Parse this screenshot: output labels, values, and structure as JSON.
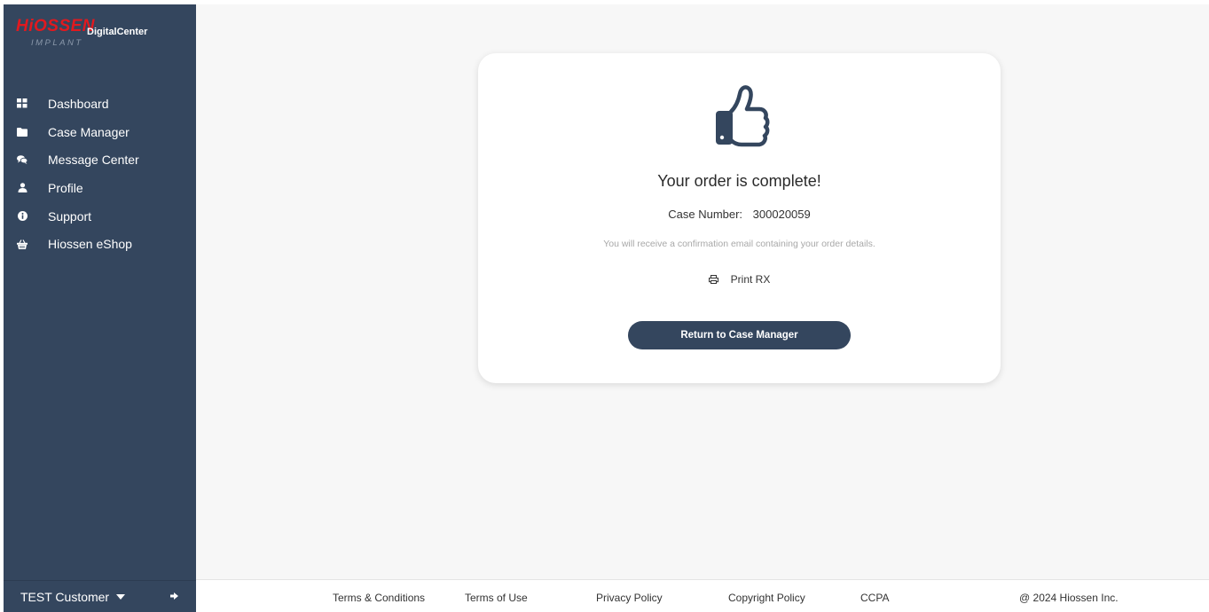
{
  "sidebar": {
    "logo": {
      "brand": "HiOSSEN",
      "product": "DigitalCenter",
      "sub": "IMPLANT"
    },
    "items": [
      {
        "label": "Dashboard",
        "icon": "grid-icon"
      },
      {
        "label": "Case Manager",
        "icon": "folder-icon"
      },
      {
        "label": "Message Center",
        "icon": "chat-icon"
      },
      {
        "label": "Profile",
        "icon": "user-icon"
      },
      {
        "label": "Support",
        "icon": "info-icon"
      },
      {
        "label": "Hiossen eShop",
        "icon": "basket-icon"
      }
    ],
    "user": {
      "name": "TEST Customer"
    }
  },
  "confirmation": {
    "title": "Your order is complete!",
    "case_label": "Case Number:",
    "case_number": "300020059",
    "note": "You will receive a confirmation email containing your order details.",
    "print_label": "Print RX",
    "return_button": "Return to Case Manager"
  },
  "footer": {
    "links": [
      "Terms & Conditions",
      "Terms of Use",
      "Privacy Policy",
      "Copyright Policy",
      "CCPA"
    ],
    "copyright": "@ 2024 Hiossen Inc."
  },
  "colors": {
    "sidebar_bg": "#34465e",
    "brand_red": "#e1191f",
    "page_bg": "#f7f7f7",
    "button_bg": "#34465e"
  }
}
